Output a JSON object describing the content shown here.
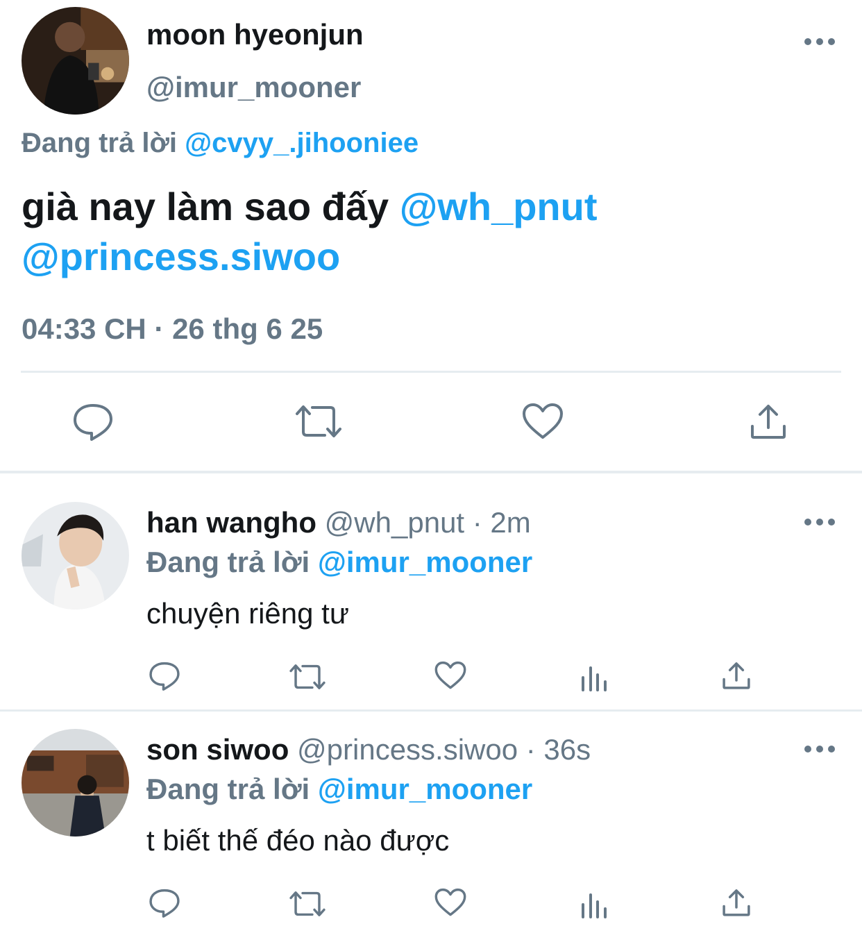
{
  "main_tweet": {
    "display_name": "moon hyeonjun",
    "handle": "@imur_mooner",
    "replying_prefix": "Đang trả lời",
    "replying_to": "@cvyy_.jihooniee",
    "text_before": "già nay làm sao đấy",
    "mention_1": "@wh_pnut",
    "mention_2": "@princess.siwoo",
    "timestamp": "04:33 CH · 26 thg 6 25"
  },
  "replies": [
    {
      "display_name": "han wangho",
      "handle": "@wh_pnut",
      "time": "· 2m",
      "replying_prefix": "Đang trả lời",
      "replying_to": "@imur_mooner",
      "text": "chuyện riêng tư"
    },
    {
      "display_name": "son siwoo",
      "handle": "@princess.siwoo",
      "time": "· 36s",
      "replying_prefix": "Đang trả lời",
      "replying_to": "@imur_mooner",
      "text": "t biết thế đéo nào được"
    }
  ],
  "icons": {
    "reply": "speech-bubble-icon",
    "retweet": "retweet-arrows-icon",
    "like": "heart-icon",
    "analytics": "bar-chart-icon",
    "share": "upload-share-icon",
    "more": "ellipsis-icon"
  },
  "colors": {
    "accent": "#1da1f2",
    "secondary_text": "#657786",
    "primary_text": "#14171a",
    "divider": "#e6ecf0"
  }
}
